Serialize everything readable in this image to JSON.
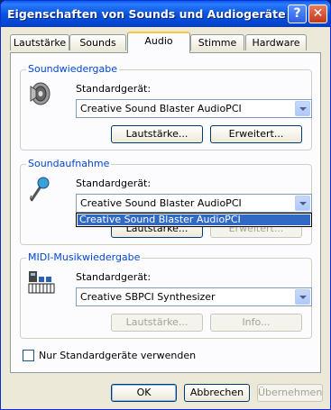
{
  "window": {
    "title": "Eigenschaften von Sounds und Audiogeräte",
    "help_label": "?",
    "close_label": "✕"
  },
  "tabs": [
    {
      "label": "Lautstärke"
    },
    {
      "label": "Sounds"
    },
    {
      "label": "Audio",
      "active": true
    },
    {
      "label": "Stimme"
    },
    {
      "label": "Hardware"
    }
  ],
  "playback": {
    "legend": "Soundwiedergabe",
    "device_label": "Standardgerät:",
    "device_value": "Creative Sound Blaster AudioPCI",
    "volume_button": "Lautstärke...",
    "advanced_button": "Erweitert...",
    "icon": "speaker-icon"
  },
  "recording": {
    "legend": "Soundaufnahme",
    "device_label": "Standardgerät:",
    "device_value": "Creative Sound Blaster AudioPCI",
    "dropdown_option": "Creative Sound Blaster AudioPCI",
    "volume_button": "Lautstärke...",
    "advanced_button": "Erweitert...",
    "icon": "microphone-icon"
  },
  "midi": {
    "legend": "MIDI-Musikwiedergabe",
    "device_label": "Standardgerät:",
    "device_value": "Creative SBPCI Synthesizer",
    "volume_button": "Lautstärke...",
    "info_button": "Info...",
    "icon": "midi-keyboard-icon"
  },
  "only_default": {
    "label": "Nur Standardgeräte verwenden",
    "checked": false
  },
  "footer": {
    "ok": "OK",
    "cancel": "Abbrechen",
    "apply": "Übernehmen"
  },
  "colors": {
    "titlebar": "#0054e3",
    "selection": "#316ac5",
    "legend": "#0046d5"
  }
}
